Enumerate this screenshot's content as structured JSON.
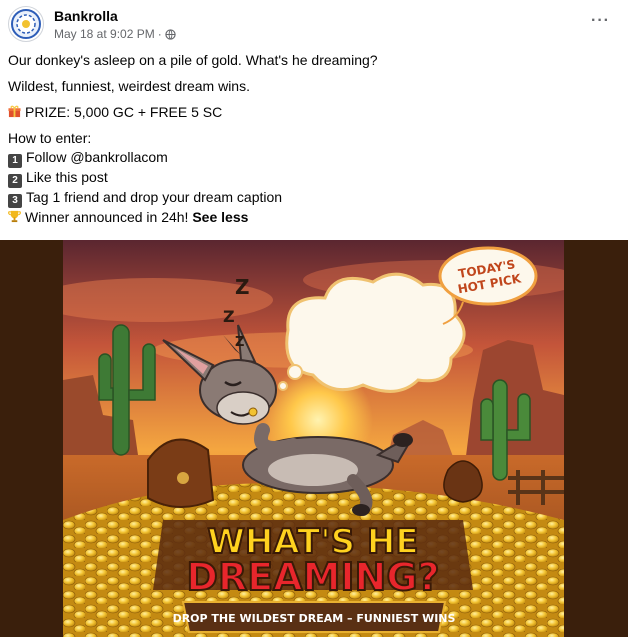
{
  "post": {
    "author": "Bankrolla",
    "timestamp": "May 18 at 9:02 PM",
    "separator": "·",
    "audience_icon": "globe-icon",
    "more_icon": "more-options-icon",
    "more_label": "···"
  },
  "text": {
    "line1": "Our donkey's asleep on a pile of gold. What's he dreaming?",
    "line2": "Wildest, funniest, weirdest dream wins.",
    "prize": "PRIZE: 5,000 GC + FREE 5 SC",
    "how_to": "How to enter:",
    "steps": [
      {
        "num": "1",
        "text": "Follow @bankrollacom"
      },
      {
        "num": "2",
        "text": "Like this post"
      },
      {
        "num": "3",
        "text": "Tag 1 friend and drop your dream caption"
      }
    ],
    "winner": "Winner announced in 24h!",
    "see_less": "See less"
  },
  "image": {
    "badge_line1": "TODAY'S",
    "badge_line2": "HOT PICK",
    "sleep_z": "Z",
    "title_line1": "WHAT'S HE",
    "title_line2": "DREAMING?",
    "banner": "DROP THE WILDEST DREAM – FUNNIEST WINS",
    "colors": {
      "sky_top": "#6b2a2a",
      "sky_bottom": "#f4a640",
      "gold": "#f2c230",
      "title_yellow": "#ffd21f",
      "title_red": "#e8262c",
      "banner_brown": "#5a3014"
    }
  }
}
